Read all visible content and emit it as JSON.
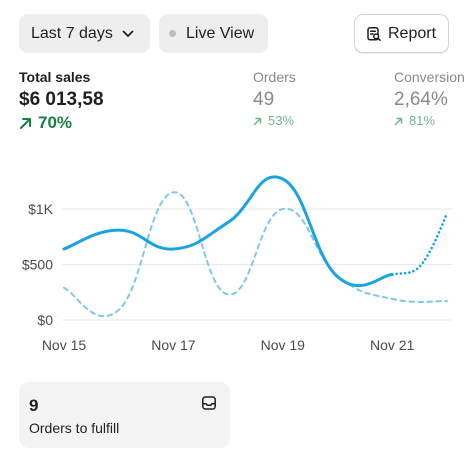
{
  "toolbar": {
    "date_range_label": "Last 7 days",
    "live_view_label": "Live View",
    "report_label": "Report"
  },
  "metrics": {
    "total_sales": {
      "label": "Total sales",
      "value": "$6 013,58",
      "change": "70%",
      "trend": "up"
    },
    "orders": {
      "label": "Orders",
      "value": "49",
      "change": "53%",
      "trend": "up"
    },
    "conversion": {
      "label": "Conversion",
      "value": "2,64%",
      "change": "81%",
      "trend": "up"
    }
  },
  "icons": {
    "date_range": "chevron-down-icon",
    "live_view": "status-dot-icon",
    "report": "report-icon",
    "trend": "arrow-up-right-icon",
    "orders_card": "inbox-icon"
  },
  "colors": {
    "accent": "#1ba3e0",
    "positive": "#1a7f46",
    "positive_muted": "#6fb88f",
    "muted_text": "#8a8a8a"
  },
  "chart_data": {
    "type": "line",
    "x_ticks": [
      "Nov 15",
      "Nov 17",
      "Nov 19",
      "Nov 21"
    ],
    "y_ticks": [
      "$0",
      "$500",
      "$1K"
    ],
    "ylim": [
      0,
      1400
    ],
    "grid": true,
    "series": [
      {
        "style": "solid",
        "color": "#1ba3e0",
        "points": [
          {
            "x": 0,
            "y": 640
          },
          {
            "x": 1,
            "y": 810
          },
          {
            "x": 2,
            "y": 640
          },
          {
            "x": 3,
            "y": 880
          },
          {
            "x": 4,
            "y": 1270
          },
          {
            "x": 5,
            "y": 390
          },
          {
            "x": 6,
            "y": 410
          }
        ]
      },
      {
        "style": "dotted",
        "color": "#1ba3e0",
        "points": [
          {
            "x": 6,
            "y": 410
          },
          {
            "x": 7,
            "y": 960
          }
        ]
      },
      {
        "style": "dashed",
        "color": "#7ec8ea",
        "points": [
          {
            "x": 0,
            "y": 290
          },
          {
            "x": 1,
            "y": 90
          },
          {
            "x": 2,
            "y": 1150
          },
          {
            "x": 3,
            "y": 230
          },
          {
            "x": 4,
            "y": 1000
          },
          {
            "x": 5,
            "y": 400
          },
          {
            "x": 6,
            "y": 190
          },
          {
            "x": 7,
            "y": 170
          }
        ]
      }
    ]
  },
  "orders_card": {
    "count": "9",
    "label": "Orders to fulfill"
  }
}
